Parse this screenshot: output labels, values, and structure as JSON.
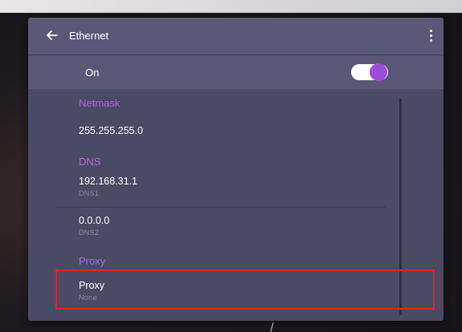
{
  "window": {
    "title": "Ethernet"
  },
  "toggle": {
    "label": "On",
    "state": "on",
    "accent": "#9b4fd8"
  },
  "sections": {
    "netmask": {
      "header": "Netmask",
      "value": "255.255.255.0"
    },
    "dns": {
      "header": "DNS",
      "dns1": {
        "value": "192.168.31.1",
        "sub": "DNS1"
      },
      "dns2": {
        "value": "0.0.0.0",
        "sub": "DNS2"
      }
    },
    "proxy": {
      "header": "Proxy",
      "item": {
        "value": "Proxy",
        "sub": "None"
      }
    }
  },
  "colors": {
    "panel": "#4b4a64",
    "header": "#5a5876",
    "section_text": "#a86be0",
    "highlight": "#d8262b"
  },
  "icons": {
    "back": "arrow-left-icon",
    "menu": "more-vert-icon"
  }
}
